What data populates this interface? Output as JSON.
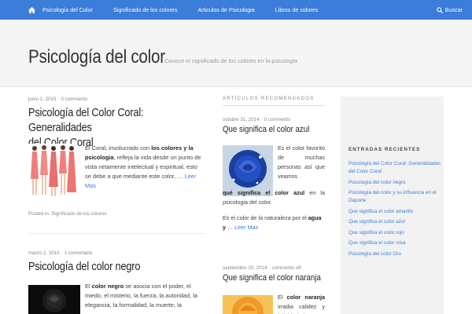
{
  "nav": {
    "items": [
      "Psicología del Color",
      "Significado de los colores",
      "Articulos de Psicologia",
      "Libros de colores"
    ],
    "search_label": "Buscar"
  },
  "header": {
    "site_title": "Psicología del color",
    "tagline": "Conoce el significado de los colores en la psicología"
  },
  "posts": [
    {
      "date": "junio 1, 2015",
      "comments": "0 comments",
      "title_line1": "Psicología del Color Coral: Generalidades",
      "title_line2": "del Color Coral",
      "excerpt_pre": "El Coral, involucrado con ",
      "excerpt_bold": "los colores y la psicologia",
      "excerpt_post": ", refleja la vida desde un punto de vista netamente intelectual y espiritual, esto se debe a que mediante este color, …",
      "read_more": "Leer Mas",
      "posted_in": "Posted in: Significado de los colores"
    },
    {
      "date": "marzo 2, 2015",
      "comments": "1 comentario",
      "title": "Psicología del color negro",
      "excerpt_pre": "El ",
      "excerpt_bold": "color negro",
      "excerpt_post": " se asocia con el poder, el miedo, el misterio, la fuerza, la autoridad, la elegancia, la formalidad, la muerte, la"
    }
  ],
  "recommended": {
    "heading": "ARTÍCULOS RECOMENDADOS",
    "items": [
      {
        "date": "octubre 31, 2014",
        "comments": "0 comments",
        "title": "Que significa el color azul",
        "text_pre": "Es el color favorito de muchas personas así que veamos ",
        "text_bold": "qué significa el color azul",
        "text_post": " en la psicologia del color.",
        "text2_pre": "Es el color de la naturaleza por el ",
        "text2_bold": "agua y",
        "text2_post": " … ",
        "read_more": "Leer Mas"
      },
      {
        "date": "septiembre 20, 2014",
        "comments": "comments off",
        "title": "Que significa el color naranja",
        "text_pre": "El ",
        "text_bold": "color naranja",
        "text_post": " irradia calidez y felicidad al"
      }
    ]
  },
  "sidebar": {
    "heading": "ENTRADAS RECIENTES",
    "items": [
      "Psicología del Color Coral: Generalidades del Color Coral",
      "Psicología del color negro",
      "Psicología del color y su influencia en el Deporte",
      "Que significa el color amarillo",
      "Que significa el color azul",
      "Que significa el color rojo",
      "Que significa el color rosa",
      "Psicología del color Oro"
    ]
  },
  "colors": {
    "nav_bg": "#3b7dd8",
    "link": "#3b7dd8"
  }
}
